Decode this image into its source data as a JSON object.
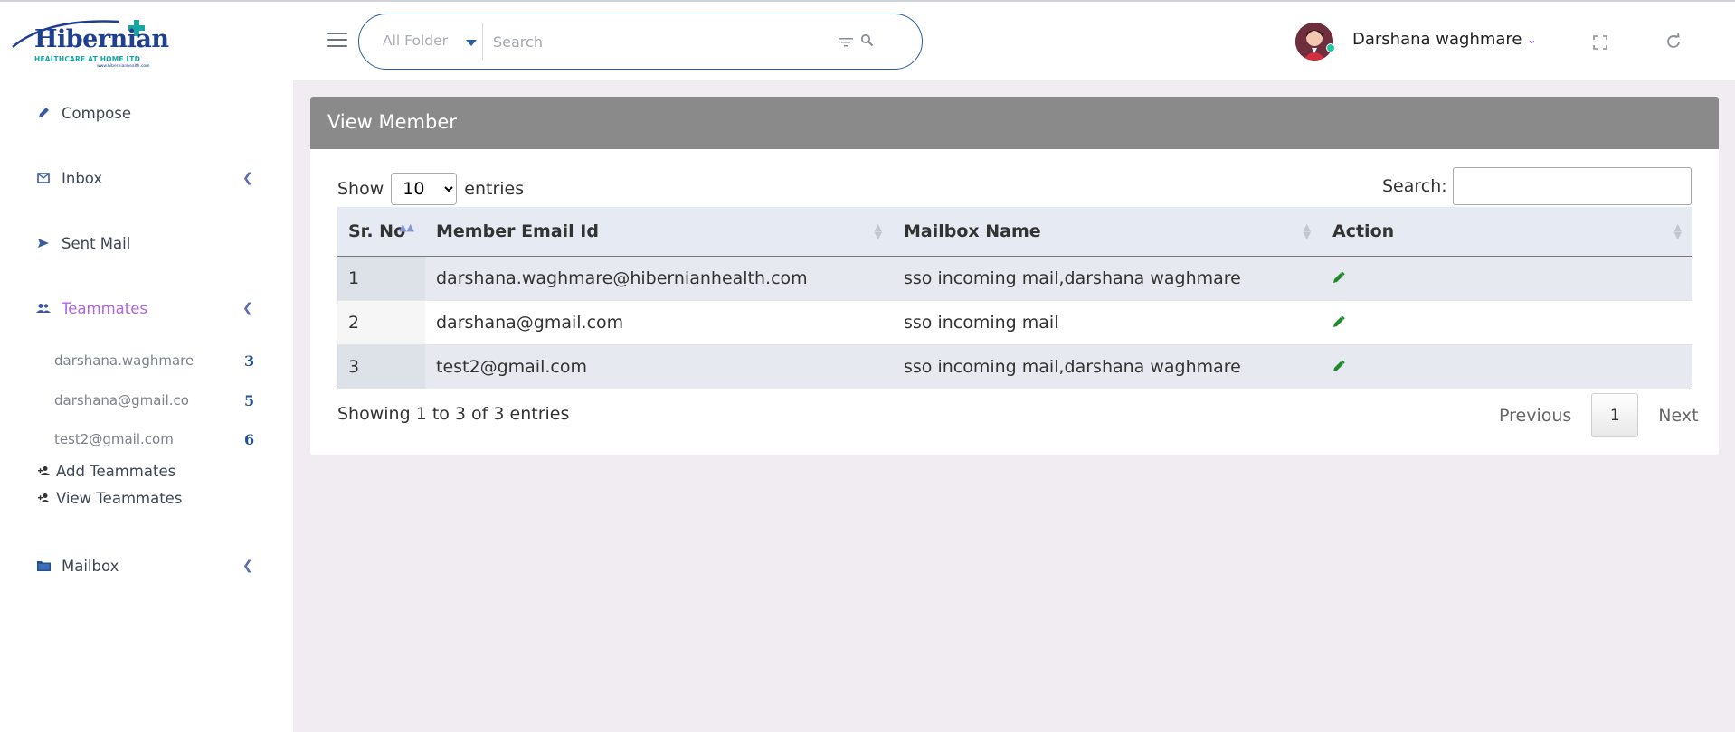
{
  "brand": {
    "name": "Hibernian",
    "tagline": "HEALTHCARE AT HOME LTD",
    "url": "www.hibernianhealth.com",
    "color": "#1f3f8f",
    "accent": "#1aa5a0"
  },
  "sidebar": {
    "compose": "Compose",
    "inbox": "Inbox",
    "sent": "Sent Mail",
    "teammates": "Teammates",
    "teammate_list": [
      {
        "name": "darshana.waghmare",
        "count": "3"
      },
      {
        "name": "darshana@gmail.co",
        "count": "5"
      },
      {
        "name": "test2@gmail.com",
        "count": "6"
      }
    ],
    "add_teammates": "Add Teammates",
    "view_teammates": "View Teammates",
    "mailbox": "Mailbox",
    "active_color": "#b265e6"
  },
  "header": {
    "folder": "All Folder",
    "search_placeholder": "Search",
    "user_name": "Darshana waghmare"
  },
  "main": {
    "card_title": "View Member",
    "show_label": "Show",
    "entries_value": "10",
    "entries_label": "entries",
    "search_label": "Search:",
    "columns": [
      "Sr. No",
      "Member Email Id",
      "Mailbox Name",
      "Action"
    ],
    "rows": [
      {
        "sr": "1",
        "email": "darshana.waghmare@hibernianhealth.com",
        "mailbox": "sso incoming mail,darshana waghmare"
      },
      {
        "sr": "2",
        "email": "darshana@gmail.com",
        "mailbox": "sso incoming mail"
      },
      {
        "sr": "3",
        "email": "test2@gmail.com",
        "mailbox": "sso incoming mail,darshana waghmare"
      }
    ],
    "info": "Showing 1 to 3 of 3 entries",
    "pager": {
      "previous": "Previous",
      "current": "1",
      "next": "Next"
    }
  }
}
